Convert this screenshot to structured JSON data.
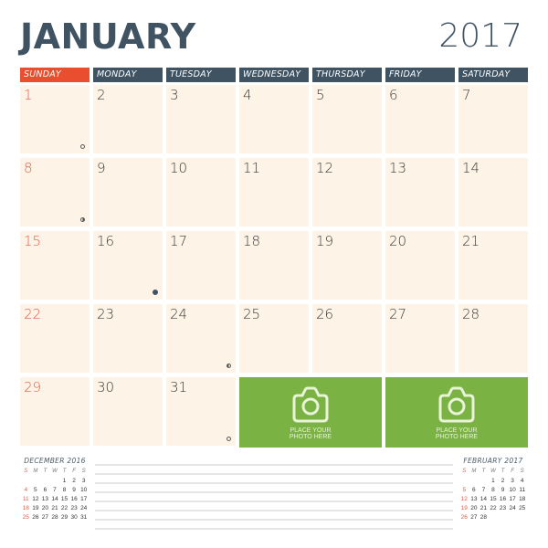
{
  "header": {
    "month": "JANUARY",
    "year": "2017"
  },
  "weekdays": [
    "SUNDAY",
    "MONDAY",
    "TUESDAY",
    "WEDNESDAY",
    "THURSDAY",
    "FRIDAY",
    "SATURDAY"
  ],
  "days": [
    "1",
    "2",
    "3",
    "4",
    "5",
    "6",
    "7",
    "8",
    "9",
    "10",
    "11",
    "12",
    "13",
    "14",
    "15",
    "16",
    "17",
    "18",
    "19",
    "20",
    "21",
    "22",
    "23",
    "24",
    "25",
    "26",
    "27",
    "28",
    "29",
    "30",
    "31"
  ],
  "moon_phases": [
    {
      "day": "1",
      "phase": "full-moon"
    },
    {
      "day": "8",
      "phase": "first-quarter"
    },
    {
      "day": "16",
      "phase": "new-moon"
    },
    {
      "day": "24",
      "phase": "last-quarter"
    },
    {
      "day": "31",
      "phase": "full-moon"
    }
  ],
  "photo_placeholders": [
    {
      "label_line1": "PLACE YOUR",
      "label_line2": "PHOTO HERE"
    },
    {
      "label_line1": "PLACE YOUR",
      "label_line2": "PHOTO HERE"
    }
  ],
  "prev_month": {
    "title": "DECEMBER 2016",
    "dow": [
      "S",
      "M",
      "T",
      "W",
      "T",
      "F",
      "S"
    ],
    "weeks": [
      [
        "",
        "",
        "",
        "",
        "1",
        "2",
        "3"
      ],
      [
        "4",
        "5",
        "6",
        "7",
        "8",
        "9",
        "10"
      ],
      [
        "11",
        "12",
        "13",
        "14",
        "15",
        "16",
        "17"
      ],
      [
        "18",
        "19",
        "20",
        "21",
        "22",
        "23",
        "24"
      ],
      [
        "25",
        "26",
        "27",
        "28",
        "29",
        "30",
        "31"
      ]
    ]
  },
  "next_month": {
    "title": "FEBRUARY 2017",
    "dow": [
      "S",
      "M",
      "T",
      "W",
      "T",
      "F",
      "S"
    ],
    "weeks": [
      [
        "",
        "",
        "",
        "1",
        "2",
        "3",
        "4"
      ],
      [
        "5",
        "6",
        "7",
        "8",
        "9",
        "10",
        "11"
      ],
      [
        "12",
        "13",
        "14",
        "15",
        "16",
        "17",
        "18"
      ],
      [
        "19",
        "20",
        "21",
        "22",
        "23",
        "24",
        "25"
      ],
      [
        "26",
        "27",
        "28",
        "",
        "",
        "",
        ""
      ]
    ]
  },
  "notes_line_count": 8,
  "colors": {
    "primary": "#3f5362",
    "sunday": "#e94e2f",
    "cell_bg": "#fdf3e6",
    "photo_bg": "#7bb244"
  }
}
